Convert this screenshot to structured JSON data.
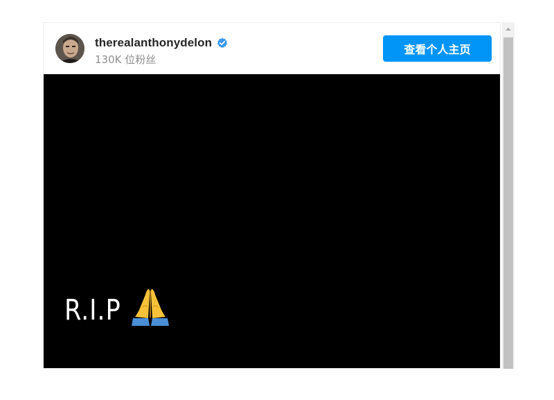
{
  "post": {
    "username": "therealanthonydelon",
    "followers": "130K 位粉丝",
    "view_profile_label": "查看个人主页",
    "media_text": "R.I.P",
    "accent_color": "#0095f6",
    "icons": {
      "avatar": "avatar-photo",
      "verified": "verified-badge-icon",
      "praying_hands": "praying-hands-emoji"
    }
  }
}
